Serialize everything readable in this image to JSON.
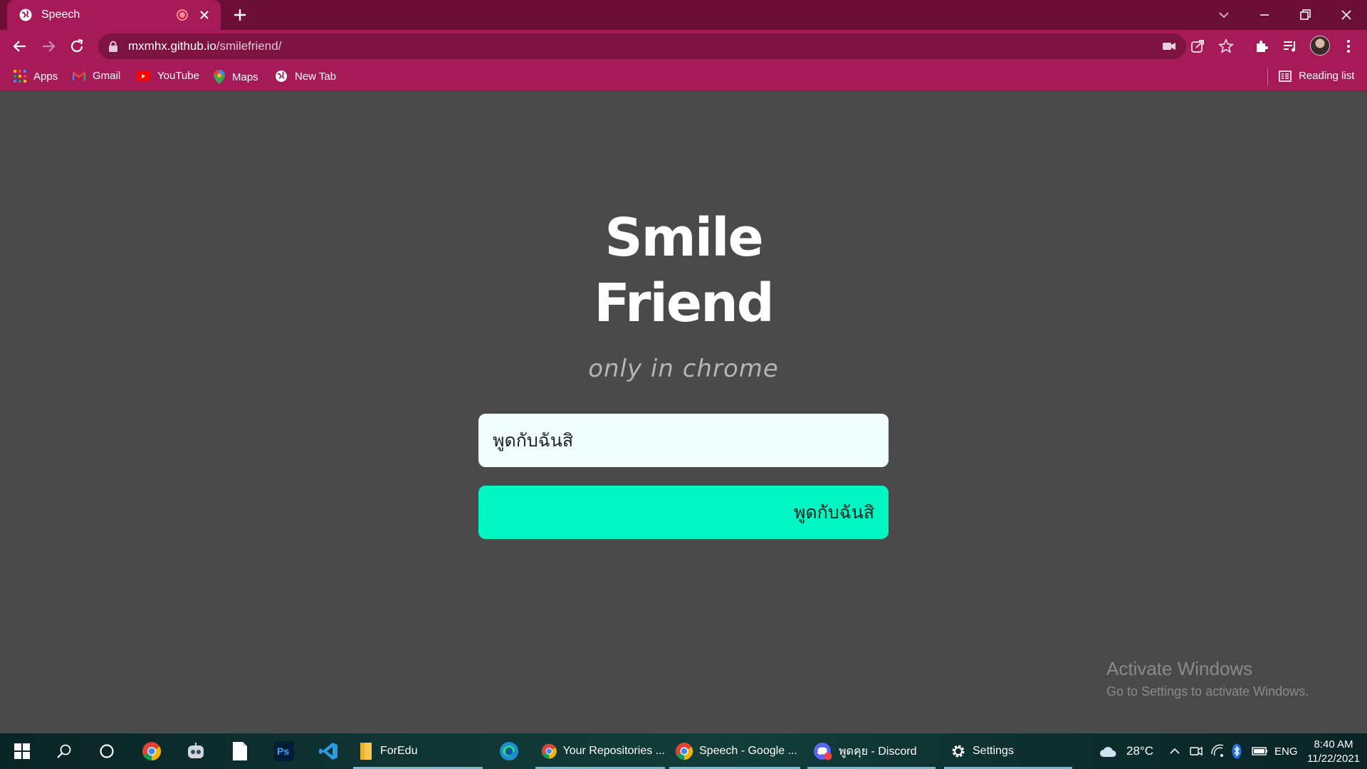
{
  "browser": {
    "tab": {
      "title": "Speech",
      "icon": "globe-icon"
    },
    "url": {
      "host": "mxmhx.github.io",
      "path": "/smilefriend/"
    },
    "bookmarks": [
      {
        "label": "Apps",
        "icon": "apps-grid-icon"
      },
      {
        "label": "Gmail",
        "icon": "gmail-icon"
      },
      {
        "label": "YouTube",
        "icon": "youtube-icon"
      },
      {
        "label": "Maps",
        "icon": "maps-icon"
      },
      {
        "label": "New Tab",
        "icon": "globe-icon"
      }
    ],
    "reading_list": "Reading list",
    "theme_colors": {
      "frame": "#6b0f36",
      "toolbar": "#a61a58",
      "omnibox": "#7c1341"
    }
  },
  "page": {
    "title_line1": "Smile",
    "title_line2": "Friend",
    "subtitle": "only in chrome",
    "input_value": "พูดกับฉันสิ",
    "button_label": "พูดกับฉันสิ",
    "colors": {
      "background": "#4a4a4a",
      "button": "#00f6c2",
      "input": "#f0fffd"
    }
  },
  "watermark": {
    "line1": "Activate Windows",
    "line2": "Go to Settings to activate Windows."
  },
  "taskbar": {
    "apps": [
      {
        "label": "ForEdu",
        "icon": "folder-icon"
      },
      {
        "label": "Your Repositories ...",
        "icon": "chrome-icon"
      },
      {
        "label": "Speech - Google ...",
        "icon": "chrome-icon"
      },
      {
        "label": "พูดคุย - Discord",
        "icon": "discord-icon"
      },
      {
        "label": "Settings",
        "icon": "gear-icon"
      }
    ],
    "weather": "28°C",
    "language": "ENG",
    "time": "8:40 AM",
    "date": "11/22/2021"
  }
}
